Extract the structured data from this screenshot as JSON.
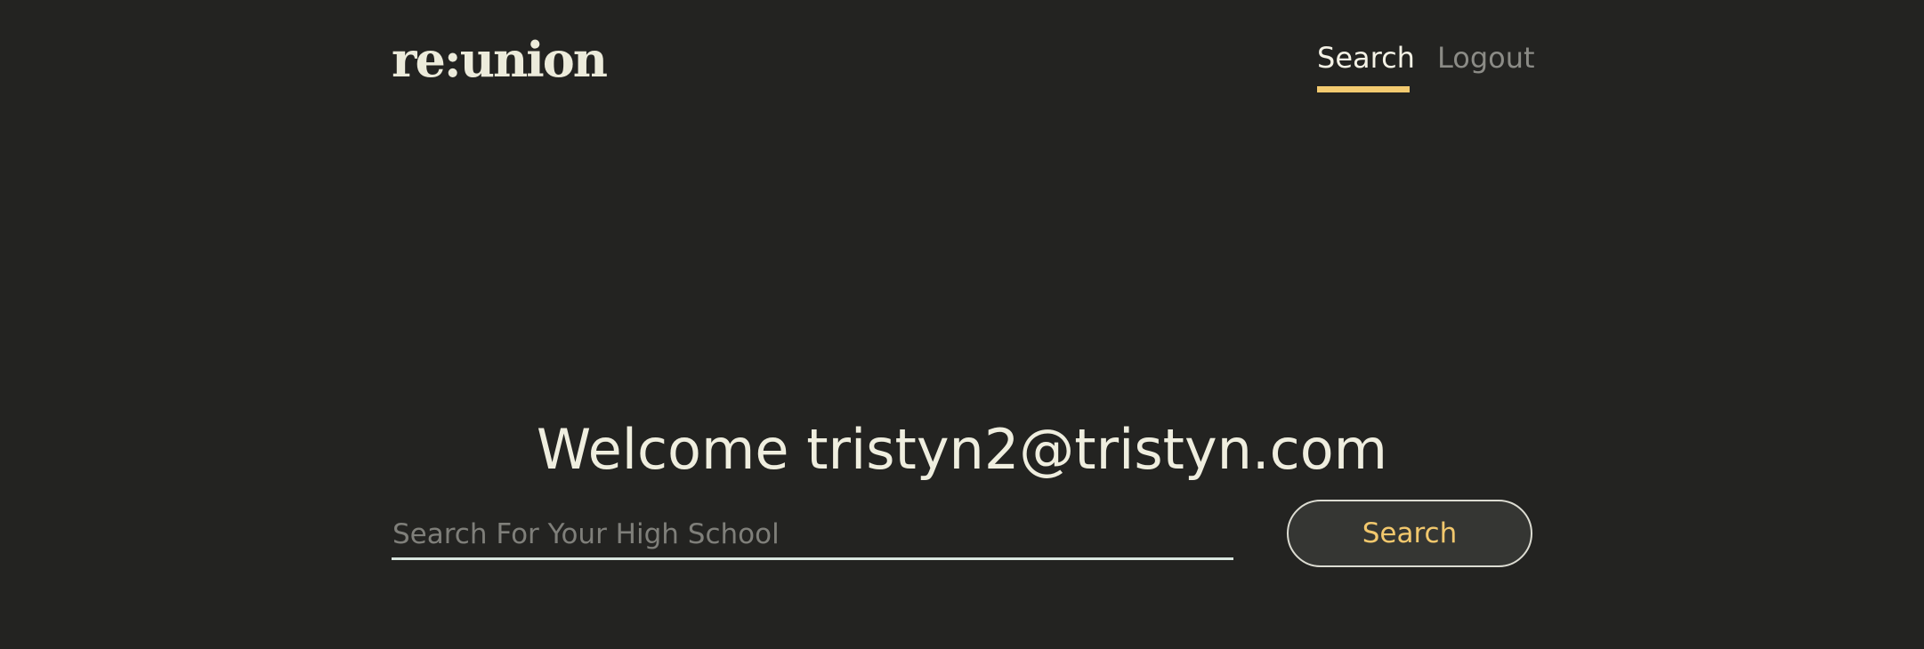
{
  "header": {
    "logo_text": "re:union",
    "nav": {
      "search_label": "Search",
      "logout_label": "Logout",
      "active_item": "Search"
    }
  },
  "main": {
    "welcome_text": "Welcome tristyn2@tristyn.com",
    "search": {
      "value": "",
      "placeholder": "Search For Your High School",
      "button_label": "Search"
    }
  },
  "colors": {
    "background": "#232321",
    "text_primary": "#efeedf",
    "text_muted": "#8b8b86",
    "accent": "#f3ca70",
    "button_background": "#353633"
  }
}
